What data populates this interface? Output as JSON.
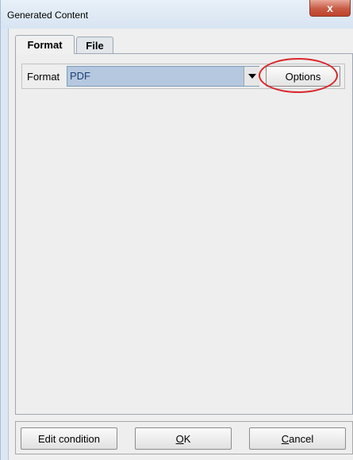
{
  "window": {
    "title": "Generated Content",
    "close_label": "x"
  },
  "tabs": [
    {
      "label": "Format",
      "selected": true
    },
    {
      "label": "File",
      "selected": false
    }
  ],
  "format_panel": {
    "format_label": "Format",
    "format_value": "PDF",
    "options_label": "Options"
  },
  "buttons": {
    "edit_condition": "Edit condition",
    "ok_mnemonic": "O",
    "ok_rest": "K",
    "cancel_mnemonic": "C",
    "cancel_rest": "ancel"
  },
  "annotation": {
    "highlight_color": "#d9262b",
    "highlight_target": "options-button"
  }
}
